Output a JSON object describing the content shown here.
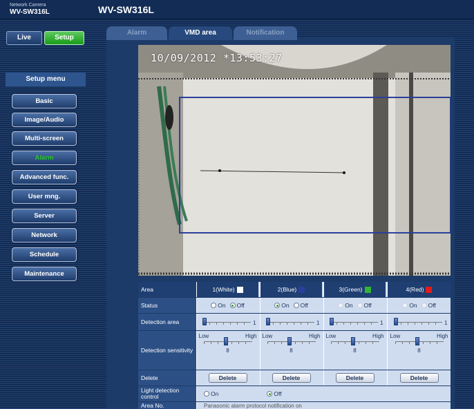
{
  "brand": {
    "small": "Network Camera",
    "model": "WV-SW316L"
  },
  "page_title": "WV-SW316L",
  "mode": {
    "live": "Live",
    "setup": "Setup"
  },
  "setup_menu": {
    "header": "Setup menu",
    "items": [
      {
        "label": "Basic",
        "active": false
      },
      {
        "label": "Image/Audio",
        "active": false
      },
      {
        "label": "Multi-screen",
        "active": false
      },
      {
        "label": "Alarm",
        "active": true
      },
      {
        "label": "Advanced func.",
        "active": false
      },
      {
        "label": "User mng.",
        "active": false
      },
      {
        "label": "Server",
        "active": false
      },
      {
        "label": "Network",
        "active": false
      },
      {
        "label": "Schedule",
        "active": false
      },
      {
        "label": "Maintenance",
        "active": false
      }
    ]
  },
  "tabs": [
    {
      "label": "Alarm",
      "selected": false
    },
    {
      "label": "VMD area",
      "selected": true
    },
    {
      "label": "Notification",
      "selected": false
    }
  ],
  "camera": {
    "timestamp": "10/09/2012 *13:53:27"
  },
  "vmd_table": {
    "labels": {
      "area": "Area",
      "status": "Status",
      "detection_area": "Detection area",
      "detection_sensitivity": "Detection sensitivity",
      "delete": "Delete",
      "light_detection": "Light detection control",
      "area_no": "Area No."
    },
    "areas": [
      {
        "name": "1(White)",
        "color": "#ffffff",
        "status": "Off",
        "detection_area": "1",
        "sensitivity": "8"
      },
      {
        "name": "2(Blue)",
        "color": "#2b3f9a",
        "status": "On",
        "detection_area": "1",
        "sensitivity": "8"
      },
      {
        "name": "3(Green)",
        "color": "#33b533",
        "status": "Off",
        "detection_area": "1",
        "sensitivity": "8"
      },
      {
        "name": "4(Red)",
        "color": "#e21b1b",
        "status": "Off",
        "detection_area": "1",
        "sensitivity": "8"
      }
    ],
    "on_label": "On",
    "off_label": "Off",
    "low_label": "Low",
    "high_label": "High",
    "delete_button": "Delete",
    "light_detection": {
      "on": "On",
      "off": "Off",
      "selected": "Off"
    },
    "area_no_text": "Panasonic alarm protocol notification on"
  }
}
